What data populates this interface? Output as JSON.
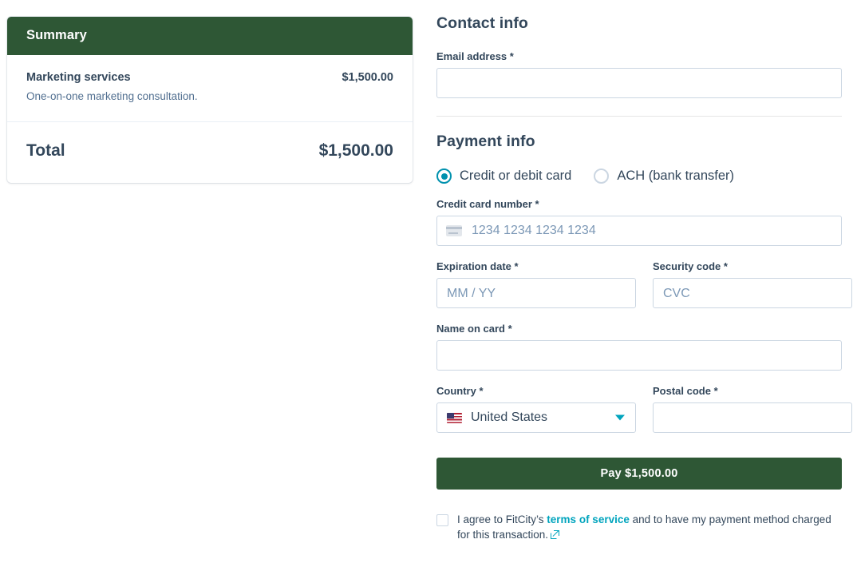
{
  "summary": {
    "header_title": "Summary",
    "items": [
      {
        "name": "Marketing services",
        "description": "One-on-one marketing consultation.",
        "price": "$1,500.00"
      }
    ],
    "total_label": "Total",
    "total_value": "$1,500.00"
  },
  "contact": {
    "section_title": "Contact info",
    "email_label": "Email address *",
    "email_value": "",
    "email_placeholder": ""
  },
  "payment": {
    "section_title": "Payment info",
    "methods": [
      {
        "label": "Credit or debit card",
        "selected": true
      },
      {
        "label": "ACH (bank transfer)",
        "selected": false
      }
    ],
    "card_number_label": "Credit card number *",
    "card_number_placeholder": "1234 1234 1234 1234",
    "card_number_value": "",
    "expiration_label": "Expiration date *",
    "expiration_placeholder": "MM / YY",
    "expiration_value": "",
    "security_label": "Security code *",
    "security_placeholder": "CVC",
    "security_value": "",
    "name_on_card_label": "Name on card *",
    "name_on_card_value": "",
    "name_on_card_placeholder": "",
    "country_label": "Country *",
    "country_value": "United States",
    "country_flag_icon": "us-flag-icon",
    "country_chevron_icon": "chevron-down-icon",
    "postal_label": "Postal code *",
    "postal_value": "",
    "postal_placeholder": "",
    "card_icon": "credit-card-icon"
  },
  "actions": {
    "pay_button_label": "Pay $1,500.00"
  },
  "terms": {
    "checked": false,
    "text_before": "I agree to FitCity’s ",
    "link_text": "terms of service",
    "text_after": " and to have my payment method charged for this transaction.",
    "external_link_icon": "external-link-icon"
  },
  "colors": {
    "brand_green": "#2e5735",
    "accent_teal": "#00a4bd",
    "radio_teal": "#0091ae",
    "text_dark": "#33475b",
    "text_muted": "#516f90",
    "placeholder": "#7c98b6",
    "border": "#cbd6e2",
    "divider": "#eaf0f6"
  }
}
